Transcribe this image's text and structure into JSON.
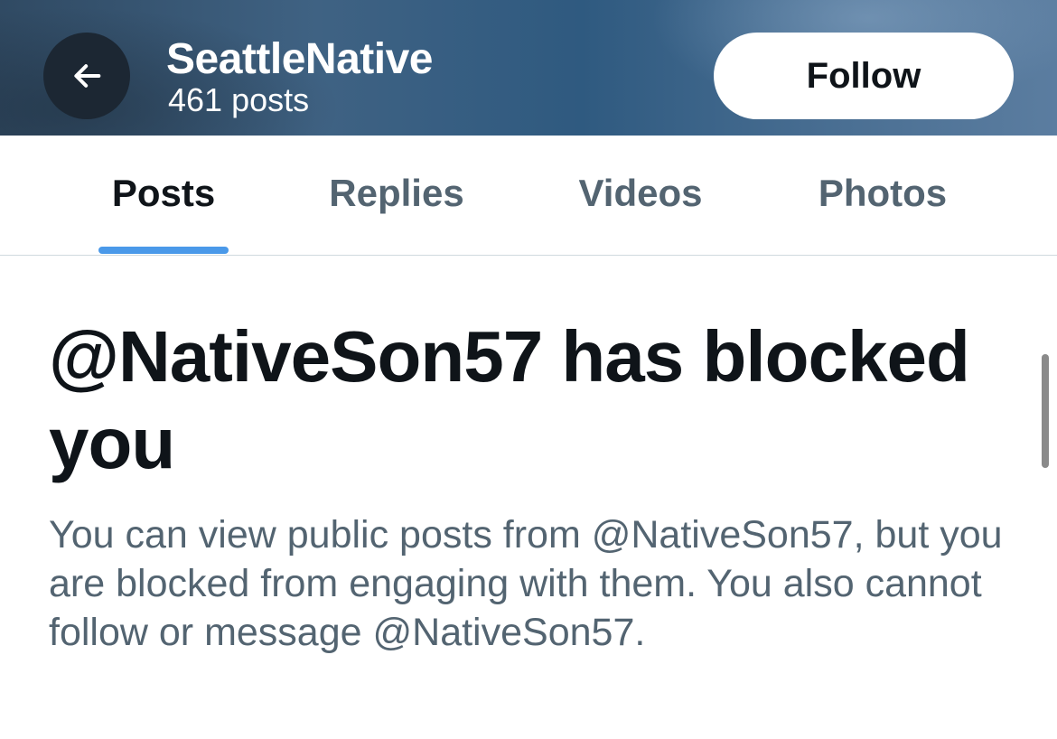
{
  "header": {
    "back_icon": "arrow-left-icon",
    "account_name": "SeattleNative",
    "post_count": "461 posts",
    "follow_label": "Follow"
  },
  "tabs": [
    {
      "label": "Posts",
      "active": true
    },
    {
      "label": "Replies",
      "active": false
    },
    {
      "label": "Videos",
      "active": false
    },
    {
      "label": "Photos",
      "active": false
    }
  ],
  "blocked_notice": {
    "title": "@NativeSon57 has blocked you",
    "body": "You can view public posts from @NativeSon57, but you are blocked from engaging with them. You also cannot follow or message @NativeSon57."
  },
  "colors": {
    "tab_indicator": "#4a99e9",
    "text_primary": "#0f1419",
    "text_secondary": "#536471",
    "back_button_bg": "#1c2733"
  }
}
